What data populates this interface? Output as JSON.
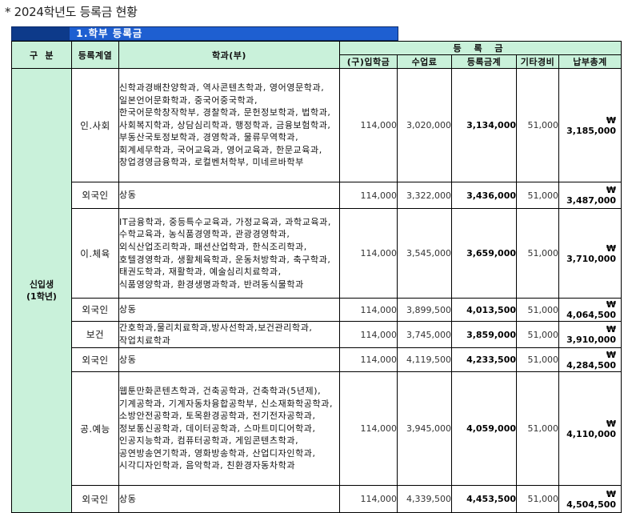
{
  "page": {
    "heading": "* 2024학년도 등록금 현황"
  },
  "section": {
    "title": "1.학부 등록금"
  },
  "table": {
    "headers": {
      "gubun": "구  분",
      "group": "등록계열",
      "dept": "학과(부)",
      "tuition_group": "등 록 금",
      "entrance": "(구)입학금",
      "class_fee": "수업료",
      "tuition_total": "등록금계",
      "other_fee": "기타경비",
      "grand_total": "납부총계"
    },
    "category": "신입생\n(1학년)",
    "rows": [
      {
        "group": "인.사회",
        "depts": "신학과경배찬양학과, 역사콘텐츠학과, 영어영문학과, 일본언어문화학과, 중국어중국학과, 한국어문학창작학부, 경찰학과, 문헌정보학과, 법학과, 사회복지학과, 상담심리학과, 행정학과, 금융보험학과, 부동산국토정보학과, 경영학과, 물류무역학과, 회계세무학과, 국어교육과, 영어교육과, 한문교육과, 창업경영금융학과, 로컬벤처학부, 미네르바학부",
        "entrance": "114,000",
        "class_fee": "3,020,000",
        "tuition_total": "3,134,000",
        "other_fee": "51,000",
        "grand_total": "₩ 3,185,000"
      },
      {
        "group": "외국인",
        "depts": "상동",
        "entrance": "114,000",
        "class_fee": "3,322,000",
        "tuition_total": "3,436,000",
        "other_fee": "51,000",
        "grand_total": "₩ 3,487,000"
      },
      {
        "group": "이.체육",
        "depts": "IT금융학과, 중등특수교육과, 가정교육과, 과학교육과, 수학교육과, 농식품경영학과, 관광경영학과, 외식산업조리학과, 패션산업학과, 한식조리학과, 호텔경영학과, 생활체육학과, 운동처방학과, 축구학과, 태권도학과, 재활학과, 예술심리치료학과, 식품영양학과, 환경생명과학과, 반려동식물학과",
        "entrance": "114,000",
        "class_fee": "3,545,000",
        "tuition_total": "3,659,000",
        "other_fee": "51,000",
        "grand_total": "₩ 3,710,000"
      },
      {
        "group": "외국인",
        "depts": "상동",
        "entrance": "114,000",
        "class_fee": "3,899,500",
        "tuition_total": "4,013,500",
        "other_fee": "51,000",
        "grand_total": "₩ 4,064,500"
      },
      {
        "group": "보건",
        "depts": "간호학과,물리치료학과,방사선학과,보건관리학과,작업치료학과",
        "entrance": "114,000",
        "class_fee": "3,745,000",
        "tuition_total": "3,859,000",
        "other_fee": "51,000",
        "grand_total": "₩ 3,910,000"
      },
      {
        "group": "외국인",
        "depts": "상동",
        "entrance": "114,000",
        "class_fee": "4,119,500",
        "tuition_total": "4,233,500",
        "other_fee": "51,000",
        "grand_total": "₩ 4,284,500"
      },
      {
        "group": "공.예능",
        "depts": "웹툰만화콘텐츠학과, 건축공학과, 건축학과(5년제), 기계공학과, 기계자동차융합공학부, 신소재화학공학과, 소방안전공학과, 토목환경공학과, 전기전자공학과, 정보통신공학과, 데이터공학과, 스마트미디어학과, 인공지능학과, 컴퓨터공학과, 게임콘텐츠학과, 공연방송연기학과, 영화방송학과, 산업디자인학과, 시각디자인학과, 음악학과, 친환경자동차학과",
        "entrance": "114,000",
        "class_fee": "3,945,000",
        "tuition_total": "4,059,000",
        "other_fee": "51,000",
        "grand_total": "₩ 4,110,000"
      },
      {
        "group": "외국인",
        "depts": "상동",
        "entrance": "114,000",
        "class_fee": "4,339,500",
        "tuition_total": "4,453,500",
        "other_fee": "51,000",
        "grand_total": "₩ 4,504,500"
      }
    ]
  }
}
